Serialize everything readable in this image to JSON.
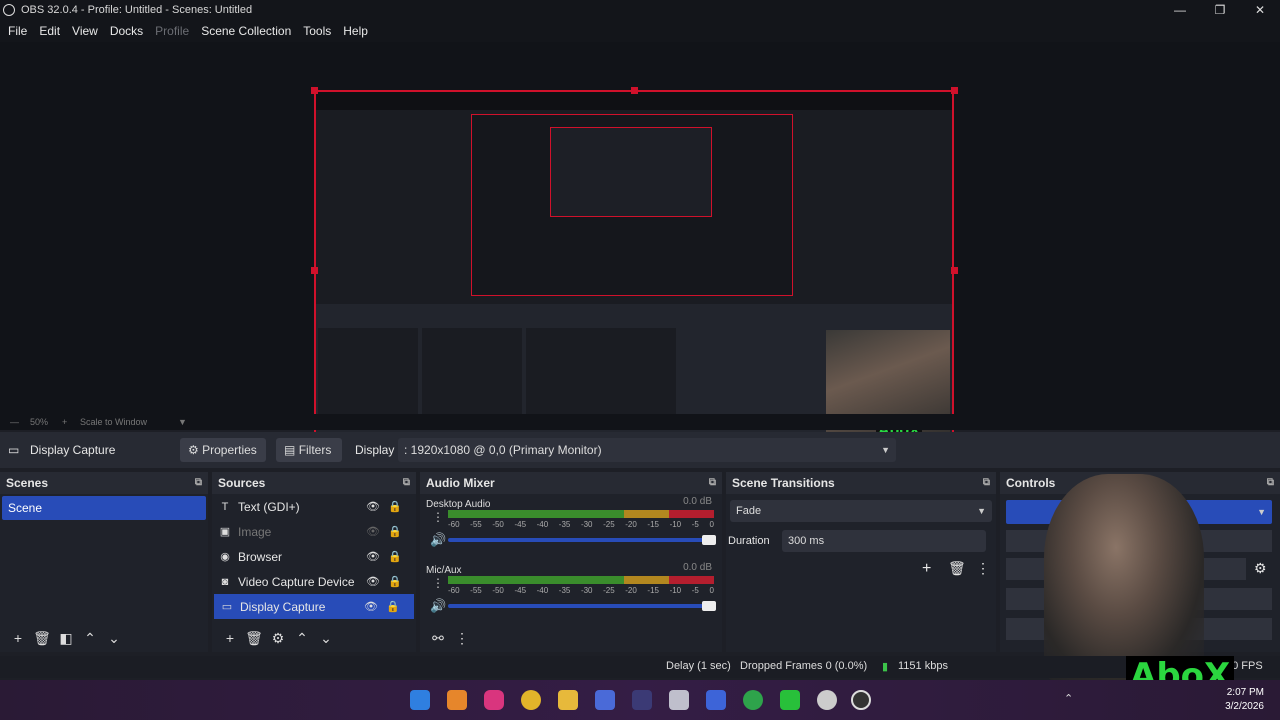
{
  "window": {
    "title": "OBS 32.0.4 - Profile: Untitled - Scenes: Untitled",
    "minimize": "—",
    "maximize": "❐",
    "close": "✕"
  },
  "menu": [
    "File",
    "Edit",
    "View",
    "Docks",
    "Profile",
    "Scene Collection",
    "Tools",
    "Help"
  ],
  "preview": {
    "watermark": "AboX",
    "zoom": "50%",
    "scale_mode": "Scale to Window"
  },
  "source_toolbar": {
    "source_name": "Display Capture",
    "properties_label": "Properties",
    "filters_label": "Filters",
    "display_label": "Display",
    "display_value": ": 1920x1080 @ 0,0 (Primary Monitor)"
  },
  "scenes": {
    "header": "Scenes",
    "items": [
      "Scene"
    ]
  },
  "sources": {
    "header": "Sources",
    "items": [
      {
        "icon": "T",
        "name": "Text (GDI+)"
      },
      {
        "icon": "▣",
        "name": "Image"
      },
      {
        "icon": "◉",
        "name": "Browser"
      },
      {
        "icon": "◙",
        "name": "Video Capture Device"
      },
      {
        "icon": "▭",
        "name": "Display Capture"
      }
    ]
  },
  "audio_mixer": {
    "header": "Audio Mixer",
    "channels": [
      {
        "name": "Desktop Audio",
        "db": "0.0 dB",
        "volume": 1.0
      },
      {
        "name": "Mic/Aux",
        "db": "0.0 dB",
        "volume": 1.0
      }
    ],
    "ticks": [
      "-60",
      "-55",
      "-50",
      "-45",
      "-40",
      "-35",
      "-30",
      "-25",
      "-20",
      "-15",
      "-10",
      "-5",
      "0"
    ]
  },
  "scene_transitions": {
    "header": "Scene Transitions",
    "transition": "Fade",
    "duration_label": "Duration",
    "duration_value": "300 ms"
  },
  "controls": {
    "header": "Controls"
  },
  "status": {
    "delay": "Delay (1 sec)",
    "dropped": "Dropped Frames 0 (0.0%)",
    "bitrate": "1151 kbps",
    "fps": "30 FPS"
  },
  "taskbar": {
    "time": "2:07 PM",
    "date": "3/2/2026"
  },
  "colors": {
    "accent": "#284cb8",
    "selection_border": "#d0112b",
    "meter_green": "#3a8d2c",
    "meter_yellow": "#b2871f",
    "meter_red": "#b41e2e"
  }
}
